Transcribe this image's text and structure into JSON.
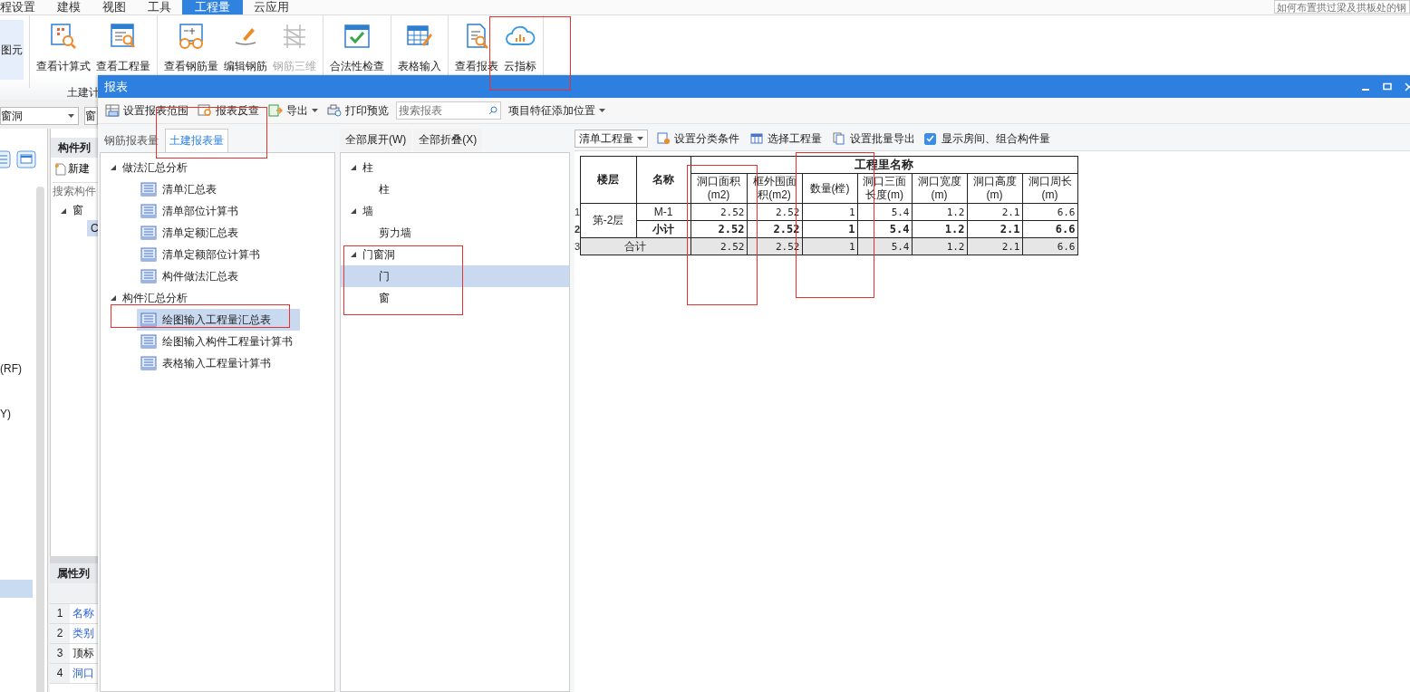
{
  "menu_bar": {
    "items": [
      {
        "label": "程设置",
        "selected": false
      },
      {
        "label": "建模",
        "selected": false
      },
      {
        "label": "视图",
        "selected": false
      },
      {
        "label": "工具",
        "selected": false
      },
      {
        "label": "工程量",
        "selected": true
      },
      {
        "label": "云应用",
        "selected": false
      }
    ],
    "search": {
      "placeholder": "如何布置拱过梁及拱板处的钢"
    }
  },
  "ribbon": {
    "lead_button": {
      "label": "图元"
    },
    "groups": [
      {
        "buttons": [
          {
            "label": "查看计算式",
            "kind": "formula",
            "disabled": false
          },
          {
            "label": "查看工程量",
            "kind": "quantity",
            "disabled": false
          }
        ]
      },
      {
        "buttons": [
          {
            "label": "查看钢筋量",
            "kind": "rebar",
            "disabled": false
          },
          {
            "label": "编辑钢筋",
            "kind": "edit",
            "disabled": false
          },
          {
            "label": "钢筋三维",
            "kind": "scaffold",
            "disabled": true
          }
        ]
      },
      {
        "buttons": [
          {
            "label": "合法性检查",
            "kind": "check",
            "disabled": false
          }
        ]
      },
      {
        "buttons": [
          {
            "label": "表格输入",
            "kind": "table",
            "disabled": false
          }
        ]
      },
      {
        "buttons": [
          {
            "label": "查看报表",
            "kind": "report",
            "disabled": false
          },
          {
            "label": "云指标",
            "kind": "cloud",
            "disabled": false
          }
        ]
      }
    ],
    "group_label": "土建计"
  },
  "side_panel": {
    "type_dropdown": {
      "value": "窗洞"
    },
    "name_dropdown": {
      "value": "窗"
    },
    "tree_items": [
      {
        "label": "(RF)"
      },
      {
        "label": "Y)"
      }
    ],
    "component_list": {
      "title": "构件列",
      "new_button": "新建",
      "search": {
        "placeholder": "搜索构件"
      },
      "tree": [
        {
          "label": "窗",
          "expanded": true,
          "children": [
            {
              "label": "C",
              "selected": true
            }
          ]
        }
      ]
    },
    "property_list": {
      "title": "属性列",
      "rows": [
        {
          "number": "1",
          "name": "名称",
          "kind": "link"
        },
        {
          "number": "2",
          "name": "类别",
          "kind": "link"
        },
        {
          "number": "3",
          "name": "顶标",
          "kind": "plain"
        },
        {
          "number": "4",
          "name": "洞口",
          "kind": "link"
        }
      ]
    }
  },
  "dialog": {
    "title": "报表",
    "toolbar": [
      {
        "label": "设置报表范围",
        "kind": "range"
      },
      {
        "label": "报表反查",
        "kind": "lookup"
      },
      {
        "label": "导出",
        "kind": "export"
      },
      {
        "label": "打印预览",
        "kind": "print"
      },
      {
        "placeholder": "搜索报表",
        "kind": "search"
      },
      {
        "label": "项目特征添加位置",
        "kind": "menu"
      }
    ],
    "tabs": [
      {
        "label": "钢筋报表量",
        "selected": false
      },
      {
        "label": "土建报表量",
        "selected": true
      }
    ],
    "report_tree": [
      {
        "label": "做法汇总分析",
        "expanded": true,
        "children": [
          {
            "label": "清单汇总表",
            "selected": false
          },
          {
            "label": "清单部位计算书",
            "selected": false
          },
          {
            "label": "清单定额汇总表",
            "selected": false
          },
          {
            "label": "清单定额部位计算书",
            "selected": false
          },
          {
            "label": "构件做法汇总表",
            "selected": false
          }
        ]
      },
      {
        "label": "构件汇总分析",
        "expanded": true,
        "children": [
          {
            "label": "绘图输入工程量汇总表",
            "selected": true
          },
          {
            "label": "绘图输入构件工程量计算书",
            "selected": false
          },
          {
            "label": "表格输入工程量计算书",
            "selected": false
          }
        ]
      }
    ],
    "tree_buttons": [
      "全部展开(W)",
      "全部折叠(X)"
    ],
    "category_tree": [
      {
        "label": "柱",
        "expanded": true,
        "children": [
          {
            "label": "柱",
            "selected": false
          }
        ]
      },
      {
        "label": "墙",
        "expanded": true,
        "children": [
          {
            "label": "剪力墙",
            "selected": false
          }
        ]
      },
      {
        "label": "门窗洞",
        "expanded": true,
        "children": [
          {
            "label": "门",
            "selected": true
          },
          {
            "label": "窗",
            "selected": false
          }
        ]
      }
    ],
    "results_toolbar": {
      "quantity_dropdown": "清单工程量",
      "buttons": [
        "设置分类条件",
        "选择工程量",
        "设置批量导出"
      ],
      "show_rooms": {
        "label": "显示房间、组合构件量",
        "checked": true
      }
    },
    "table": {
      "group_header": "工程里名称",
      "columns": [
        "楼层",
        "名称",
        "洞口面积(m2)",
        "框外围面积(m2)",
        "数量(樘)",
        "洞口三面长度(m)",
        "洞口宽度(m)",
        "洞口高度(m)",
        "洞口周长(m)"
      ],
      "rows": [
        {
          "number": "1",
          "kind": "item",
          "floor": "第-2层",
          "name": "M-1",
          "values": [
            "2.52",
            "2.52",
            "1",
            "5.4",
            "1.2",
            "2.1",
            "6.6"
          ]
        },
        {
          "number": "2",
          "kind": "subtotal",
          "name": "小计",
          "values": [
            "2.52",
            "2.52",
            "1",
            "5.4",
            "1.2",
            "2.1",
            "6.6"
          ]
        },
        {
          "number": "3",
          "kind": "total",
          "name": "合计",
          "values": [
            "2.52",
            "2.52",
            "1",
            "5.4",
            "1.2",
            "2.1",
            "6.6"
          ]
        }
      ]
    }
  }
}
